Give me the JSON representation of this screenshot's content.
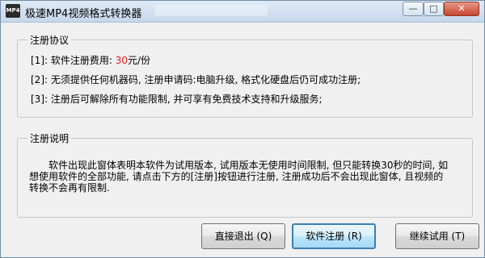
{
  "window": {
    "title": "极速MP4视频格式转换器",
    "icon_label": "MP4",
    "minimize_icon": "—",
    "maximize_icon": "□",
    "close_icon": "✕"
  },
  "agreement": {
    "title": "注册协议",
    "line1_prefix": "[1]: 软件注册费用: ",
    "line1_fee": "30",
    "line1_suffix": "元/份",
    "line2": "[2]: 无须提供任何机器码, 注册申请码:电脑升级, 格式化硬盘后仍可成功注册;",
    "line3": "[3]: 注册后可解除所有功能限制, 并可享有免费技术支持和升级服务;"
  },
  "notice": {
    "title": "注册说明",
    "text": "软件出现此窗体表明本软件为试用版本, 试用版本无使用时间限制, 但只能转换30秒的时间, 如想使用软件的全部功能, 请点击下方的[注册]按钮进行注册, 注册成功后不会出现此窗体, 且视频的转换不会再有限制."
  },
  "buttons": {
    "exit": "直接退出 (Q)",
    "register": "软件注册 (R)",
    "trial": "继续试用 (T)"
  },
  "colors": {
    "fee": "#e02020",
    "window_bg": "#f0f0f0"
  }
}
